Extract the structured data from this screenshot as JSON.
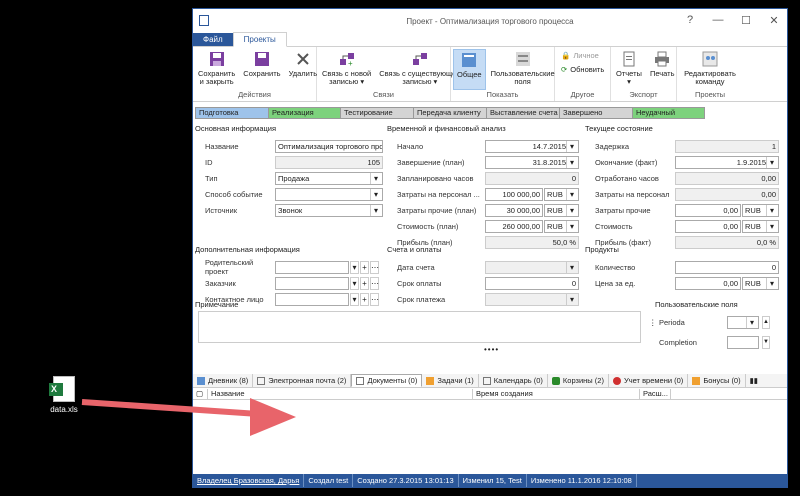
{
  "desktop": {
    "file_label": "data.xls"
  },
  "window": {
    "title": "Проект - Оптимализация торгового процесса"
  },
  "tabs": {
    "file": "Файл",
    "projects": "Проекты"
  },
  "ribbon": {
    "actions": {
      "save_close": "Сохранить\nи закрыть",
      "save": "Сохранить",
      "delete": "Удалить",
      "label": "Действия"
    },
    "links": {
      "link_new": "Связь с новой\nзаписью ▾",
      "link_existing": "Связь с существующей\nзаписью ▾",
      "label": "Связи"
    },
    "show": {
      "general": "Общее",
      "user_fields": "Пользовательские\nполя",
      "label": "Показать"
    },
    "other": {
      "private": "Личное",
      "refresh": "Обновить",
      "label": "Другое"
    },
    "export": {
      "reports": "Отчеты\n▾",
      "print": "Печать",
      "label": "Экспорт"
    },
    "projects": {
      "edit_command": "Редактировать\nкоманду",
      "label": "Проекты"
    }
  },
  "stages": [
    {
      "label": "Подготовка",
      "color": "#9ec3ea"
    },
    {
      "label": "Реализация",
      "color": "#7dd27d"
    },
    {
      "label": "Тестирование",
      "color": "#d4d4d4"
    },
    {
      "label": "Передача клиенту",
      "color": "#d4d4d4"
    },
    {
      "label": "Выставление счета",
      "color": "#d4d4d4"
    },
    {
      "label": "Завершено",
      "color": "#d4d4d4"
    },
    {
      "label": "Неудачный",
      "color": "#7dd27d"
    }
  ],
  "basic": {
    "title": "Основная информация",
    "name_label": "Название",
    "name_value": "Оптимализация торгового процес",
    "id_label": "ID",
    "id_value": "105",
    "type_label": "Тип",
    "type_value": "Продажа",
    "method_label": "Способ событие",
    "method_value": "",
    "source_label": "Источник",
    "source_value": "Звонок"
  },
  "timefin": {
    "title": "Временной и финансовый анализ",
    "start_label": "Начало",
    "start_value": "14.7.2015",
    "end_label": "Завершение (план)",
    "end_value": "31.8.2015",
    "planned_hours_label": "Запланировано часов",
    "planned_hours_value": "0",
    "staff_costs_label": "Затраты на персонал ...",
    "staff_costs_value": "100 000,00",
    "staff_costs_cur": "RUB",
    "other_costs_label": "Затраты прочие (план)",
    "other_costs_value": "30 000,00",
    "other_costs_cur": "RUB",
    "cost_label": "Стоимость (план)",
    "cost_value": "260 000,00",
    "cost_cur": "RUB",
    "profit_label": "Прибыль (план)",
    "profit_value": "50,0 %"
  },
  "current": {
    "title": "Текущее состояние",
    "delay_label": "Задержка",
    "delay_value": "1",
    "end_fact_label": "Окончание (факт)",
    "end_fact_value": "1.9.2015",
    "worked_hours_label": "Отработано часов",
    "worked_hours_value": "0,00",
    "staff_costs_label": "Затраты на персонал",
    "staff_costs_value": "0,00",
    "other_costs_label": "Затраты прочие",
    "other_costs_value": "0,00",
    "other_costs_cur": "RUB",
    "cost_label": "Стоимость",
    "cost_value": "0,00",
    "cost_cur": "RUB",
    "profit_label": "Прибыль (факт)",
    "profit_value": "0,0 %"
  },
  "additional": {
    "title": "Дополнительная информация",
    "parent_label": "Родительский проект",
    "customer_label": "Заказчик",
    "contact_label": "Контактное лицо"
  },
  "invoices": {
    "title": "Счета и оплаты",
    "invoice_date_label": "Дата счета",
    "payment_term_label": "Срок оплаты",
    "payment_term_value": "0",
    "payment_due_label": "Срок платежа"
  },
  "products": {
    "title": "Продукты",
    "qty_label": "Количество",
    "qty_value": "0",
    "price_label": "Цена за ед.",
    "price_value": "0,00",
    "price_cur": "RUB"
  },
  "note": {
    "title": "Примечание"
  },
  "user_fields": {
    "title": "Пользовательские поля",
    "period_label": "Perioda",
    "completion_label": "Completion"
  },
  "detail_tabs": [
    "Дневник (8)",
    "Электронная почта (2)",
    "Документы (0)",
    "Задачи (1)",
    "Календарь (0)",
    "Корзины (2)",
    "Учет времени (0)",
    "Бонусы (0)"
  ],
  "grid_headers": {
    "name": "Название",
    "created": "Время создания",
    "ext": "Расш..."
  },
  "status": {
    "owner": "Владелец Бразовская, Дарья",
    "created_by": "Создал test",
    "created_at": "Создано 27.3.2015 13:01:13",
    "changed_by": "Изменил 15, Test",
    "changed_at": "Изменено 11.1.2016 12:10:08"
  }
}
